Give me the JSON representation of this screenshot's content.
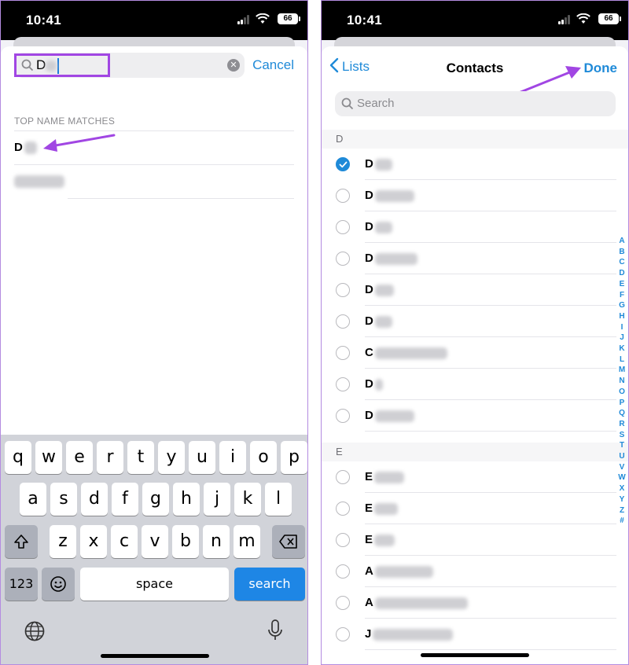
{
  "status": {
    "time": "10:41",
    "battery": "66"
  },
  "left": {
    "search": {
      "typed": "D"
    },
    "cancel_label": "Cancel",
    "section_label": "TOP NAME MATCHES",
    "matches": [
      {
        "name": "D"
      },
      {
        "name": ""
      }
    ],
    "keyboard": {
      "row1": [
        "q",
        "w",
        "e",
        "r",
        "t",
        "y",
        "u",
        "i",
        "o",
        "p"
      ],
      "row2": [
        "a",
        "s",
        "d",
        "f",
        "g",
        "h",
        "j",
        "k",
        "l"
      ],
      "row3": [
        "z",
        "x",
        "c",
        "v",
        "b",
        "n",
        "m"
      ],
      "numbers_label": "123",
      "space_label": "space",
      "search_label": "search"
    }
  },
  "right": {
    "back_label": "Lists",
    "title": "Contacts",
    "done_label": "Done",
    "search_placeholder": "Search",
    "sections": [
      {
        "letter": "D",
        "contacts": [
          {
            "initial": "D",
            "checked": true
          },
          {
            "initial": "D",
            "checked": false
          },
          {
            "initial": "D",
            "checked": false
          },
          {
            "initial": "D",
            "checked": false
          },
          {
            "initial": "D",
            "checked": false
          },
          {
            "initial": "D",
            "checked": false
          },
          {
            "initial": "C",
            "checked": false
          },
          {
            "initial": "D",
            "checked": false
          },
          {
            "initial": "D",
            "checked": false
          }
        ]
      },
      {
        "letter": "E",
        "contacts": [
          {
            "initial": "E",
            "checked": false
          },
          {
            "initial": "E",
            "checked": false
          },
          {
            "initial": "E",
            "checked": false
          },
          {
            "initial": "A",
            "checked": false
          },
          {
            "initial": "A",
            "checked": false
          },
          {
            "initial": "J",
            "checked": false
          }
        ]
      }
    ],
    "index_letters": [
      "A",
      "B",
      "C",
      "D",
      "E",
      "F",
      "G",
      "H",
      "I",
      "J",
      "K",
      "L",
      "M",
      "N",
      "O",
      "P",
      "Q",
      "R",
      "S",
      "T",
      "U",
      "V",
      "W",
      "X",
      "Y",
      "Z",
      "#"
    ]
  },
  "colors": {
    "accent": "#1f8ad8",
    "annotation": "#a146e3",
    "keyboard": "#d1d3d9"
  }
}
